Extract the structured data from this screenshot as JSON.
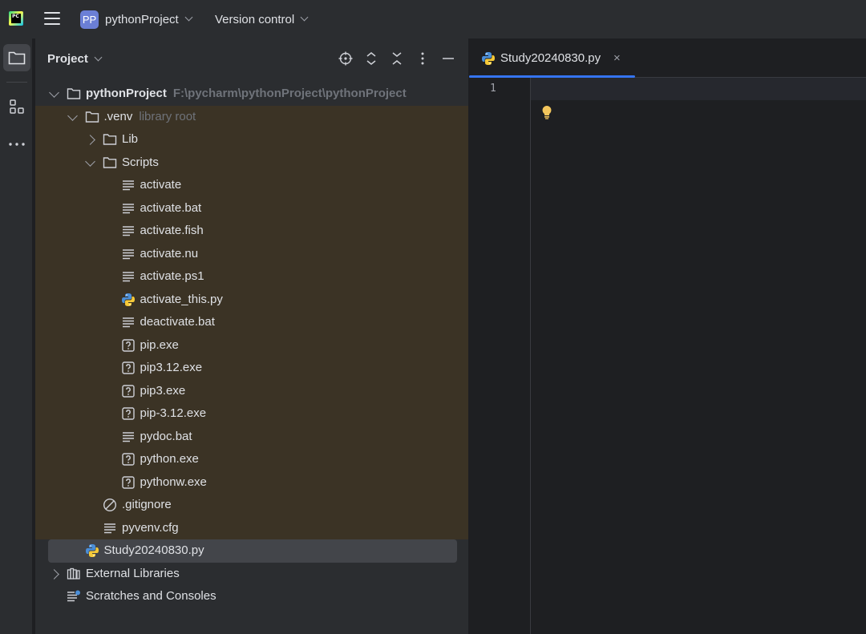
{
  "titlebar": {
    "logo_text": "PC",
    "project_badge": "PP",
    "project_name": "pythonProject",
    "vcs_label": "Version control"
  },
  "project_panel": {
    "title": "Project",
    "tree": [
      {
        "label": "pythonProject",
        "hint": "F:\\pycharm\\pythonProject\\pythonProject",
        "icon": "folder-icon",
        "expanded": true,
        "level": 0
      },
      {
        "label": ".venv",
        "hint": "library root",
        "icon": "folder-icon",
        "expanded": true,
        "level": 1
      },
      {
        "label": "Lib",
        "icon": "folder-icon",
        "expanded": false,
        "level": 2
      },
      {
        "label": "Scripts",
        "icon": "folder-icon",
        "expanded": true,
        "level": 2
      },
      {
        "label": "activate",
        "icon": "text-file-icon",
        "level": 3
      },
      {
        "label": "activate.bat",
        "icon": "text-file-icon",
        "level": 3
      },
      {
        "label": "activate.fish",
        "icon": "text-file-icon",
        "level": 3
      },
      {
        "label": "activate.nu",
        "icon": "text-file-icon",
        "level": 3
      },
      {
        "label": "activate.ps1",
        "icon": "text-file-icon",
        "level": 3
      },
      {
        "label": "activate_this.py",
        "icon": "python-file-icon",
        "level": 3
      },
      {
        "label": "deactivate.bat",
        "icon": "text-file-icon",
        "level": 3
      },
      {
        "label": "pip.exe",
        "icon": "unknown-file-icon",
        "level": 3
      },
      {
        "label": "pip3.12.exe",
        "icon": "unknown-file-icon",
        "level": 3
      },
      {
        "label": "pip3.exe",
        "icon": "unknown-file-icon",
        "level": 3
      },
      {
        "label": "pip-3.12.exe",
        "icon": "unknown-file-icon",
        "level": 3
      },
      {
        "label": "pydoc.bat",
        "icon": "text-file-icon",
        "level": 3
      },
      {
        "label": "python.exe",
        "icon": "unknown-file-icon",
        "level": 3
      },
      {
        "label": "pythonw.exe",
        "icon": "unknown-file-icon",
        "level": 3
      },
      {
        "label": ".gitignore",
        "icon": "ignored-file-icon",
        "level": 2
      },
      {
        "label": "pyvenv.cfg",
        "icon": "text-file-icon",
        "level": 2
      },
      {
        "label": "Study20240830.py",
        "icon": "python-file-icon",
        "level": 1
      },
      {
        "label": "External Libraries",
        "icon": "library-icon",
        "expanded": false,
        "level": 0
      },
      {
        "label": "Scratches and Consoles",
        "icon": "scratches-icon",
        "level": 0
      }
    ]
  },
  "editor": {
    "tab_label": "Study20240830.py",
    "close_glyph": "×",
    "line_number": "1"
  }
}
